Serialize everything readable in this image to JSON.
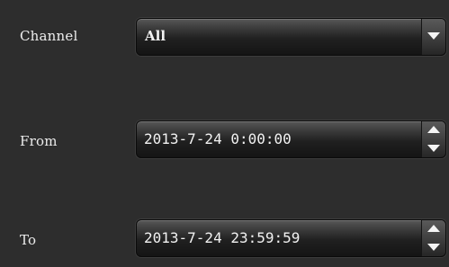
{
  "labels": {
    "channel": "Channel",
    "from": "From",
    "to": "To"
  },
  "channel": {
    "selected": "All"
  },
  "from": {
    "value": "2013-7-24 0:00:00"
  },
  "to": {
    "value": "2013-7-24 23:59:59"
  },
  "icons": {
    "dropdown": "chevron-down-icon",
    "spin_up": "arrow-up-icon",
    "spin_down": "arrow-down-icon"
  },
  "colors": {
    "background": "#2d2d2d",
    "text": "#f2f2f2"
  }
}
